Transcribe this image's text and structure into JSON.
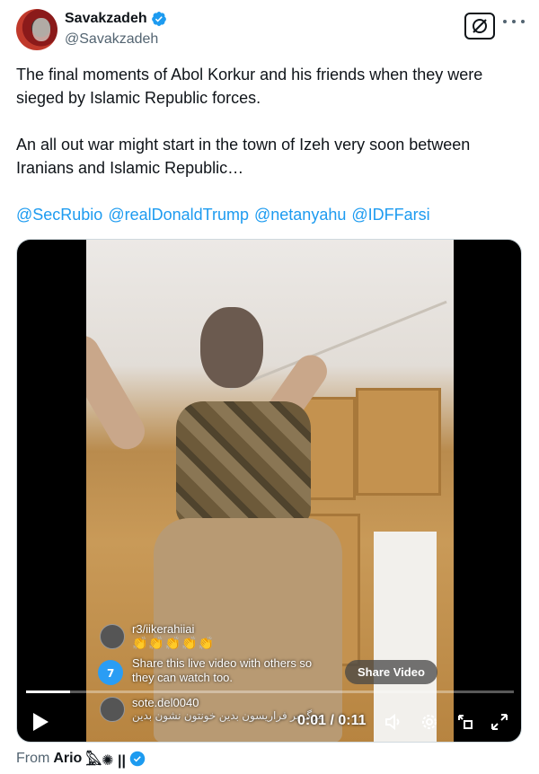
{
  "author": {
    "display_name": "Savakzadeh",
    "handle": "@Savakzadeh",
    "verified_icon": "verified-badge-icon",
    "verified_color": "#1d9bf0"
  },
  "header_actions": {
    "grok_icon": "grok-icon",
    "more_icon": "more-dots-icon"
  },
  "tweet": {
    "paragraph1": "The final moments of Abol Korkur and his friends when they were sieged by Islamic Republic forces.",
    "paragraph2": "An all out war might start in the town of Izeh very soon between Iranians and Islamic Republic…",
    "mentions": [
      "@SecRubio",
      "@realDonaldTrump",
      "@netanyahu",
      "@IDFFarsi"
    ]
  },
  "video": {
    "overlay_comment_top_name": "r3/iikerahiiai",
    "overlay_emojis": "👏👏👏👏👏",
    "share_live_text": "Share this live video with others so they can watch too.",
    "share_video_label": "Share Video",
    "bottom_comment_name": "sote.del0040",
    "bottom_comment_text": "مرگ بر فراریسون بدین خونتون نشون بدین",
    "time": "0:01 / 0:11",
    "progress": 0.09,
    "play_icon": "play-icon",
    "volume_icon": "volume-icon",
    "settings_icon": "settings-gear-icon",
    "pip_icon": "picture-in-picture-icon",
    "fullscreen_icon": "fullscreen-icon"
  },
  "attribution": {
    "prefix": "From",
    "name": "Ario",
    "suffix": "𓅓✺ ||"
  }
}
